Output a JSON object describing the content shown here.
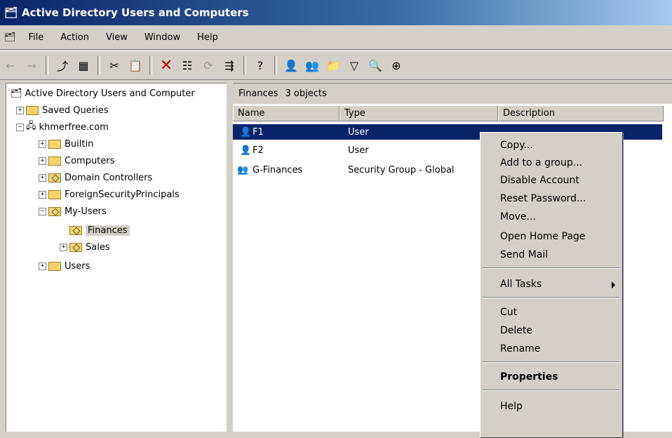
{
  "window": {
    "title": "Active Directory Users and Computers",
    "title_icon": "snapin-icon"
  },
  "menubar": [
    "File",
    "Action",
    "View",
    "Window",
    "Help"
  ],
  "toolbar": {
    "icons": [
      "back-arrow-icon",
      "forward-arrow-icon",
      "up-folder-icon",
      "show-hide-tree-icon",
      "cut-icon",
      "paste-icon",
      "delete-icon",
      "properties-icon",
      "refresh-icon",
      "export-list-icon",
      "help-icon",
      "new-user-icon",
      "new-group-icon",
      "new-ou-icon",
      "filter-icon",
      "find-icon",
      "add-to-group-icon"
    ]
  },
  "tree": {
    "root": "Active Directory Users and Computer",
    "items": [
      {
        "label": "Saved Queries",
        "expander": "+"
      },
      {
        "label": "khmerfree.com",
        "expander": "−"
      },
      {
        "label": "Builtin",
        "expander": "+"
      },
      {
        "label": "Computers",
        "expander": "+"
      },
      {
        "label": "Domain Controllers",
        "expander": "+"
      },
      {
        "label": "ForeignSecurityPrincipals",
        "expander": "+"
      },
      {
        "label": "My-Users",
        "expander": "−"
      },
      {
        "label": "Finances",
        "expander": ""
      },
      {
        "label": "Sales",
        "expander": "+"
      },
      {
        "label": "Users",
        "expander": "+"
      }
    ]
  },
  "list": {
    "header_label": "Finances",
    "object_count": "3 objects",
    "columns": [
      "Name",
      "Type",
      "Description"
    ],
    "rows": [
      {
        "name": "F1",
        "type": "User",
        "description": ""
      },
      {
        "name": "F2",
        "type": "User",
        "description": ""
      },
      {
        "name": "G-Finances",
        "type": "Security Group - Global",
        "description": ""
      }
    ]
  },
  "context_menu": {
    "items": [
      "Copy...",
      "Add to a group...",
      "Disable Account",
      "Reset Password...",
      "Move...",
      "Open Home Page",
      "Send Mail",
      "All Tasks",
      "Cut",
      "Delete",
      "Rename",
      "Properties",
      "Help"
    ]
  },
  "colors": {
    "selection": "#0a246a",
    "title_start": "#0a246a",
    "title_end": "#a6caf0",
    "chrome": "#d4d0c8"
  }
}
